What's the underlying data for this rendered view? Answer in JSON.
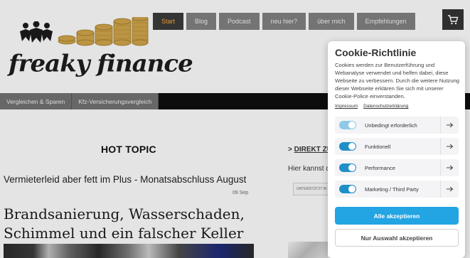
{
  "logo": {
    "text": "freaky finance"
  },
  "topnav": {
    "items": [
      {
        "label": "Start",
        "active": true
      },
      {
        "label": "Blog"
      },
      {
        "label": "Podcast"
      },
      {
        "label": "neu hier?"
      },
      {
        "label": "über mich"
      },
      {
        "label": "Empfehlungen"
      }
    ],
    "cart_icon": "shopping-cart-icon",
    "active_color": "#f2a93b"
  },
  "subnav": {
    "items": [
      {
        "label": "Vergleichen & Sparen"
      },
      {
        "label": "Kfz-Versicherungsvergleich"
      }
    ]
  },
  "main": {
    "section_heading": "HOT TOPIC",
    "post1": {
      "title": "Vermieterleid aber fett im Plus - Monatsabschluss August",
      "date": "09 Sep"
    },
    "post2": {
      "title": "Brandsanierung, Wasserschaden, Schimmel und ein falscher Keller"
    }
  },
  "sidebar": {
    "direct_prefix": "> ",
    "direct_link": "DIREKT ZU",
    "intro": "Hier kannst d",
    "select_label": "UNTERSTÜTZT W"
  },
  "cookie": {
    "title": "Cookie-Richtlinie",
    "description": "Cookies werden zur Benutzerführung und Webanalyse verwendet und helfen dabei, diese Webseite zu verbessern. Durch die weitere Nutzung dieser Webseite erklären Sie sich mit unserer Cookie-Police einverstanden.",
    "links": [
      "Impressum",
      "Datenschutzerklärung"
    ],
    "categories": [
      {
        "label": "Unbedingt erforderlich",
        "enabled": true,
        "locked": true
      },
      {
        "label": "Funktionell",
        "enabled": true
      },
      {
        "label": "Performance",
        "enabled": true
      },
      {
        "label": "Marketing / Third Party",
        "enabled": true
      }
    ],
    "accept_all": "Alle akzeptieren",
    "accept_selection": "Nur Auswahl akzeptieren",
    "accent_color": "#22a5e2"
  }
}
